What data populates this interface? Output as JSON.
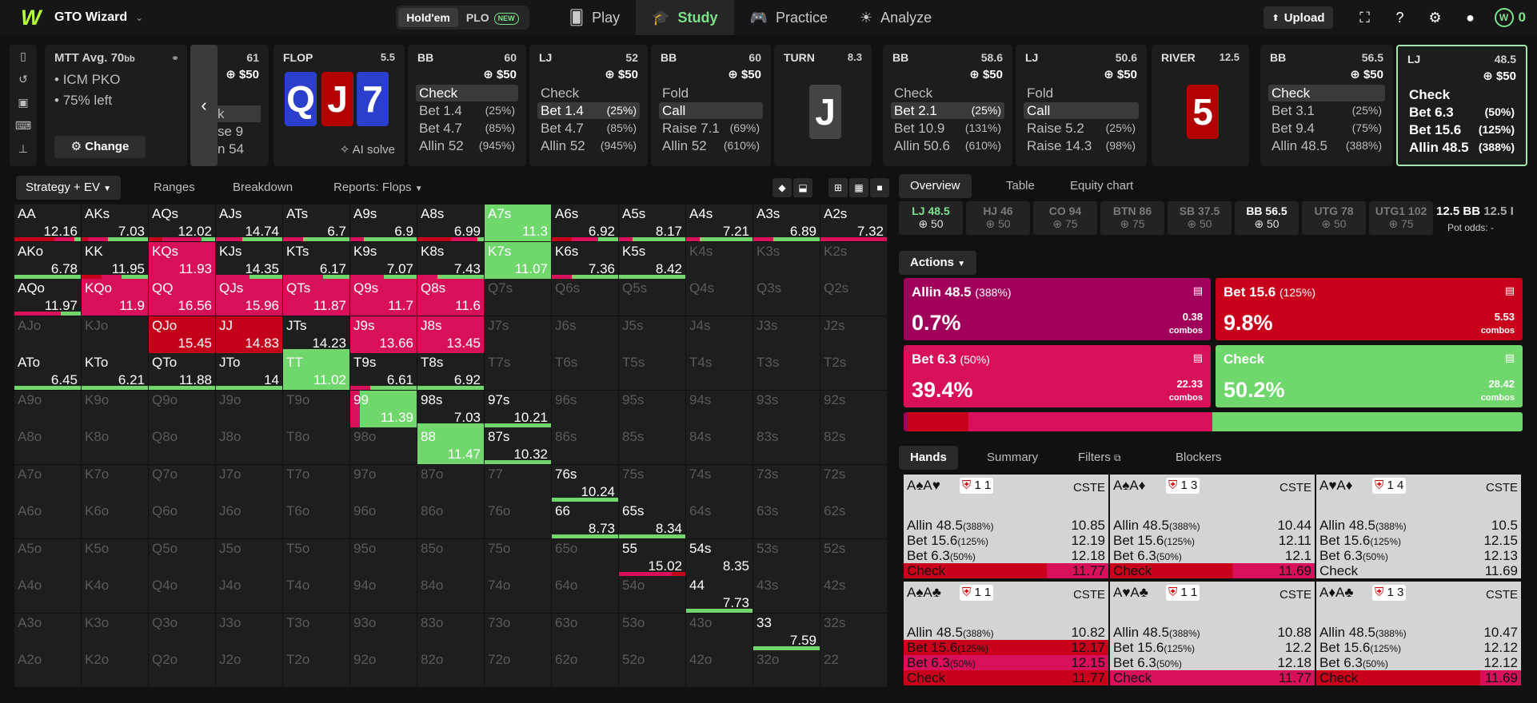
{
  "app": {
    "name": "GTO Wizard"
  },
  "game_toggle": [
    {
      "label": "Hold'em",
      "active": true
    },
    {
      "label": "PLO",
      "badge": "NEW"
    }
  ],
  "nav": [
    {
      "label": "Play",
      "icon": "cards-icon"
    },
    {
      "label": "Study",
      "icon": "graduation-cap-icon",
      "active": true
    },
    {
      "label": "Practice",
      "icon": "gamepad-icon"
    },
    {
      "label": "Analyze",
      "icon": "lightbulb-icon"
    }
  ],
  "toolbar": {
    "upload": "Upload",
    "coins": "0"
  },
  "mtt": {
    "format": "MTT",
    "depth": "Avg. 70",
    "depth_unit": "bb",
    "lines": [
      "ICM PKO",
      "75% left"
    ],
    "change": "Change"
  },
  "partial_card": {
    "num": "61",
    "pot": "$50",
    "opts": [
      "k",
      "se 9",
      "n 54"
    ]
  },
  "flop": {
    "label": "FLOP",
    "pot": "5.5",
    "cards": [
      "Q",
      "J",
      "7"
    ],
    "ai": "AI solve"
  },
  "action_cards": [
    {
      "pos": "BB",
      "num": "60",
      "pot": "$50",
      "opts": [
        {
          "t": "Check",
          "p": "",
          "s": "sel"
        },
        {
          "t": "Bet 1.4",
          "p": "(25%)"
        },
        {
          "t": "Bet 4.7",
          "p": "(85%)"
        },
        {
          "t": "Allin 52",
          "p": "(945%)"
        }
      ]
    },
    {
      "pos": "LJ",
      "num": "52",
      "pot": "$50",
      "opts": [
        {
          "t": "Check",
          "p": ""
        },
        {
          "t": "Bet 1.4",
          "p": "(25%)",
          "s": "sel"
        },
        {
          "t": "Bet 4.7",
          "p": "(85%)"
        },
        {
          "t": "Allin 52",
          "p": "(945%)"
        }
      ]
    },
    {
      "pos": "BB",
      "num": "60",
      "pot": "$50",
      "opts": [
        {
          "t": "Fold",
          "p": ""
        },
        {
          "t": "Call",
          "p": "",
          "s": "sel"
        },
        {
          "t": "Raise 7.1",
          "p": "(69%)"
        },
        {
          "t": "Allin 52",
          "p": "(610%)"
        }
      ]
    }
  ],
  "turn": {
    "label": "TURN",
    "pot": "8.3",
    "card": "J"
  },
  "action_cards2": [
    {
      "pos": "BB",
      "num": "58.6",
      "pot": "$50",
      "opts": [
        {
          "t": "Check",
          "p": ""
        },
        {
          "t": "Bet 2.1",
          "p": "(25%)",
          "s": "sel"
        },
        {
          "t": "Bet 10.9",
          "p": "(131%)"
        },
        {
          "t": "Allin 50.6",
          "p": "(610%)"
        }
      ]
    },
    {
      "pos": "LJ",
      "num": "50.6",
      "pot": "$50",
      "opts": [
        {
          "t": "Fold",
          "p": ""
        },
        {
          "t": "Call",
          "p": "",
          "s": "sel"
        },
        {
          "t": "Raise 5.2",
          "p": "(25%)"
        },
        {
          "t": "Raise 14.3",
          "p": "(98%)"
        }
      ]
    }
  ],
  "river": {
    "label": "RIVER",
    "pot": "12.5",
    "card": "5"
  },
  "action_cards3": [
    {
      "pos": "BB",
      "num": "56.5",
      "pot": "$50",
      "opts": [
        {
          "t": "Check",
          "p": "",
          "s": "sel"
        },
        {
          "t": "Bet 3.1",
          "p": "(25%)"
        },
        {
          "t": "Bet 9.4",
          "p": "(75%)"
        },
        {
          "t": "Allin 48.5",
          "p": "(388%)"
        }
      ]
    },
    {
      "pos": "LJ",
      "num": "48.5",
      "pot": "$50",
      "opts": [
        {
          "t": "Check",
          "p": ""
        },
        {
          "t": "Bet 6.3",
          "p": "(50%)"
        },
        {
          "t": "Bet 15.6",
          "p": "(125%)"
        },
        {
          "t": "Allin 48.5",
          "p": "(388%)"
        }
      ]
    }
  ],
  "grid_tabs": {
    "strategy": "Strategy + EV",
    "ranges": "Ranges",
    "breakdown": "Breakdown",
    "reports": "Reports: Flops"
  },
  "colors": {
    "green": "#6fd76b",
    "red": "#c4001a",
    "pink": "#d8105a",
    "magenta": "#a0004f",
    "gray": "#1e1e1e"
  },
  "grid": [
    [
      "AA|12.16|r60p30g10",
      "AKs|7.03|r10p30g60",
      "AQs|12.02|r20p60g20",
      "AJs|14.74|p40g60",
      "ATs|6.7|p30g70",
      "A9s|6.9|p20g80",
      "A8s|6.99|r50p40g10",
      "A7s|11.3|G",
      "A6s|6.92|r30p40g30",
      "A5s|8.17|p20g80",
      "A4s|7.21|p20g80",
      "A3s|6.89|p30g70",
      "A2s|7.32|p100"
    ],
    [
      "AKo|6.78|g100",
      "KK|11.95|r30p30g40",
      "KQs|11.93|P",
      "KJs|14.35|p50g50",
      "KTs|6.17|p60g40",
      "K9s|7.07|p50g50",
      "K8s|7.43|p30g70",
      "K7s|11.07|G",
      "K6s|7.36|p30g70",
      "K5s|8.42|g100",
      "K4s||",
      "K3s||",
      "K2s||"
    ],
    [
      "AQo|11.97|p70g30",
      "KQo|11.9|P",
      "QQ|16.56|P",
      "QJs|15.96|P",
      "QTs|11.87|P",
      "Q9s|11.7|P",
      "Q8s|11.6|P",
      "Q7s||",
      "Q6s||",
      "Q5s||",
      "Q4s||",
      "Q3s||",
      "Q2s||"
    ],
    [
      "AJo||",
      "KJo||",
      "QJo|15.45|R",
      "JJ|14.83|R",
      "JTs|14.23|g100",
      "J9s|13.66|P",
      "J8s|13.45|P",
      "J7s||",
      "J6s||",
      "J5s||",
      "J4s||",
      "J3s||",
      "J2s||"
    ],
    [
      "ATo|6.45|g100",
      "KTo|6.21|g100",
      "QTo|11.88|g100",
      "JTo|14|g100",
      "TT|11.02|G",
      "T9s|6.61|p30g70",
      "T8s|6.92|g100",
      "T7s||",
      "T6s||",
      "T5s||",
      "T4s||",
      "T3s||",
      "T2s||"
    ],
    [
      "A9o||",
      "K9o||",
      "Q9o||",
      "J9o||",
      "T9o||",
      "99|11.39|p15G",
      "98s|7.03|g100",
      "97s|10.21|g100",
      "96s||",
      "95s||",
      "94s||",
      "93s||",
      "92s||"
    ],
    [
      "A8o||",
      "K8o||",
      "Q8o||",
      "J8o||",
      "T8o||",
      "98o||",
      "88|11.47|G",
      "87s|10.32|g100",
      "86s||",
      "85s||",
      "84s||",
      "83s||",
      "82s||"
    ],
    [
      "A7o||",
      "K7o||",
      "Q7o||",
      "J7o||",
      "T7o||",
      "97o||",
      "87o||",
      "77||",
      "76s|10.24|g100",
      "75s||",
      "74s||",
      "73s||",
      "72s||"
    ],
    [
      "A6o||",
      "K6o||",
      "Q6o||",
      "J6o||",
      "T6o||",
      "96o||",
      "86o||",
      "76o||",
      "66|8.73|g100",
      "65s|8.34|g100",
      "64s||",
      "63s||",
      "62s||"
    ],
    [
      "A5o||",
      "K5o||",
      "Q5o||",
      "J5o||",
      "T5o||",
      "95o||",
      "85o||",
      "75o||",
      "65o||",
      "55|15.02|p80r20",
      "54s|8.35|",
      "53s||",
      "52s||"
    ],
    [
      "A4o||",
      "K4o||",
      "Q4o||",
      "J4o||",
      "T4o||",
      "94o||",
      "84o||",
      "74o||",
      "64o||",
      "54o||",
      "44|7.73|g100",
      "43s||",
      "42s||"
    ],
    [
      "A3o||",
      "K3o||",
      "Q3o||",
      "J3o||",
      "T3o||",
      "93o||",
      "83o||",
      "73o||",
      "63o||",
      "53o||",
      "43o||",
      "33|7.59|g100",
      "32s||"
    ],
    [
      "A2o||",
      "K2o||",
      "Q2o||",
      "J2o||",
      "T2o||",
      "92o||",
      "82o||",
      "72o||",
      "62o||",
      "52o||",
      "42o||",
      "32o||",
      "22||"
    ]
  ],
  "right_tabs": {
    "overview": "Overview",
    "table": "Table",
    "equity": "Equity chart"
  },
  "positions": [
    {
      "name": "LJ 48.5",
      "stack": "50",
      "state": "act"
    },
    {
      "name": "HJ 46",
      "stack": "50"
    },
    {
      "name": "CO 94",
      "stack": "75"
    },
    {
      "name": "BTN 86",
      "stack": "75"
    },
    {
      "name": "SB 37.5",
      "stack": "50"
    },
    {
      "name": "BB 56.5",
      "stack": "50",
      "state": "mid"
    },
    {
      "name": "UTG 78",
      "stack": "50"
    },
    {
      "name": "UTG1 102",
      "stack": "75"
    }
  ],
  "pot_info": {
    "pot": "12.5 BB",
    "partial": "12.5 I",
    "odds_label": "Pot odds:",
    "odds": "-"
  },
  "actions_label": "Actions",
  "actions": [
    {
      "label": "Allin 48.5",
      "pct_label": "(388%)",
      "freq": "0.7%",
      "combos": "0.38",
      "combos_label": "combos",
      "color": "#a0005a"
    },
    {
      "label": "Bet 15.6",
      "pct_label": "(125%)",
      "freq": "9.8%",
      "combos": "5.53",
      "combos_label": "combos",
      "color": "#c8001c"
    },
    {
      "label": "Bet 6.3",
      "pct_label": "(50%)",
      "freq": "39.4%",
      "combos": "22.33",
      "combos_label": "combos",
      "color": "#d8105a"
    },
    {
      "label": "Check",
      "pct_label": "",
      "freq": "50.2%",
      "combos": "28.42",
      "combos_label": "combos",
      "color": "#6fd76b"
    }
  ],
  "freq_bar": [
    0.7,
    9.8,
    39.4,
    50.2
  ],
  "hands_tabs": {
    "hands": "Hands",
    "summary": "Summary",
    "filters": "Filters",
    "blockers": "Blockers"
  },
  "hands": [
    {
      "cards": "A♠A♥",
      "blk": "1 1",
      "cs": "CSTE",
      "rows": [
        [
          "Allin 48.5",
          "(388%)",
          "10.85"
        ],
        [
          "Bet 15.6",
          "(125%)",
          "12.19"
        ],
        [
          "Bet 6.3",
          "(50%)",
          "12.18"
        ],
        [
          "Check",
          "",
          "11.77"
        ]
      ],
      "mix": [
        0,
        0,
        0,
        100
      ]
    },
    {
      "cards": "A♠A♦",
      "blk": "1 3",
      "cs": "CSTE",
      "rows": [
        [
          "Allin 48.5",
          "(388%)",
          "10.44"
        ],
        [
          "Bet 15.6",
          "(125%)",
          "12.11"
        ],
        [
          "Bet 6.3",
          "(50%)",
          "12.1"
        ],
        [
          "Check",
          "",
          "11.69"
        ]
      ],
      "mix": [
        0,
        0,
        20,
        80
      ]
    },
    {
      "cards": "A♥A♦",
      "blk": "1 4",
      "cs": "CSTE",
      "rows": [
        [
          "Allin 48.5",
          "(388%)",
          "10.5"
        ],
        [
          "Bet 15.6",
          "(125%)",
          "12.15"
        ],
        [
          "Bet 6.3",
          "(50%)",
          "12.13"
        ],
        [
          "Check",
          "",
          "11.69"
        ]
      ],
      "mix": [
        0,
        0,
        0,
        0
      ]
    },
    {
      "cards": "A♠A♣",
      "blk": "1 1",
      "cs": "CSTE",
      "rows": [
        [
          "Allin 48.5",
          "(388%)",
          "10.82"
        ],
        [
          "Bet 15.6",
          "(125%)",
          "12.17"
        ],
        [
          "Bet 6.3",
          "(50%)",
          "12.15"
        ],
        [
          "Check",
          "",
          "11.77"
        ]
      ],
      "mix": [
        0,
        60,
        20,
        20
      ]
    },
    {
      "cards": "A♥A♣",
      "blk": "1 1",
      "cs": "CSTE",
      "rows": [
        [
          "Allin 48.5",
          "(388%)",
          "10.88"
        ],
        [
          "Bet 15.6",
          "(125%)",
          "12.2"
        ],
        [
          "Bet 6.3",
          "(50%)",
          "12.18"
        ],
        [
          "Check",
          "",
          "11.77"
        ]
      ],
      "mix": [
        0,
        0,
        80,
        20
      ]
    },
    {
      "cards": "A♦A♣",
      "blk": "1 3",
      "cs": "CSTE",
      "rows": [
        [
          "Allin 48.5",
          "(388%)",
          "10.47"
        ],
        [
          "Bet 15.6",
          "(125%)",
          "12.12"
        ],
        [
          "Bet 6.3",
          "(50%)",
          "12.12"
        ],
        [
          "Check",
          "",
          "11.69"
        ]
      ],
      "mix": [
        0,
        0,
        40,
        60
      ]
    }
  ]
}
